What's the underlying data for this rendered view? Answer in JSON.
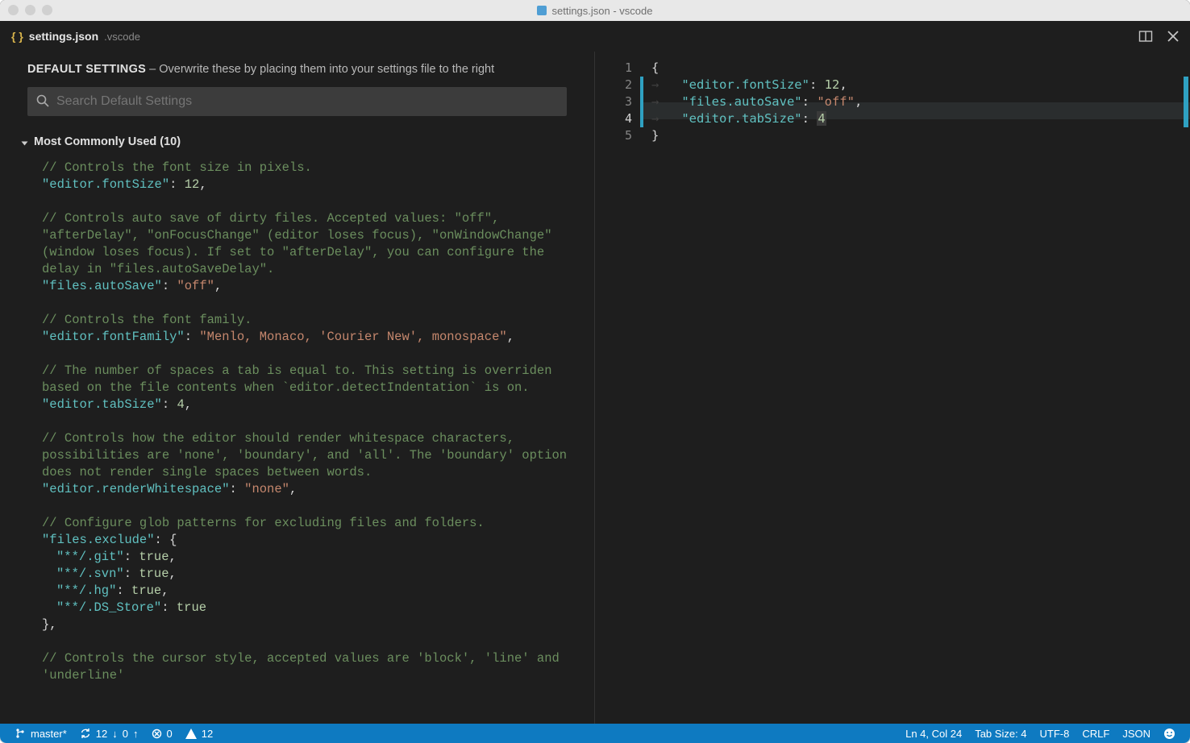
{
  "titlebar": {
    "title": "settings.json - vscode"
  },
  "tab": {
    "filename": "settings.json",
    "folder": ".vscode"
  },
  "defaultSettings": {
    "heading": "DEFAULT SETTINGS",
    "hint": " – Overwrite these by placing them into your settings file to the right",
    "searchPlaceholder": "Search Default Settings",
    "section": "Most Commonly Used (10)",
    "entries": [
      {
        "comment": "// Controls the font size in pixels.",
        "key": "\"editor.fontSize\"",
        "value": "12",
        "vtype": "num",
        "trail": ","
      },
      {
        "comment": "// Controls auto save of dirty files. Accepted values:  \"off\", \"afterDelay\", \"onFocusChange\" (editor loses focus), \"onWindowChange\" (window loses focus). If set to \"afterDelay\", you can configure the delay in \"files.autoSaveDelay\".",
        "key": "\"files.autoSave\"",
        "value": "\"off\"",
        "vtype": "str",
        "trail": ","
      },
      {
        "comment": "// Controls the font family.",
        "key": "\"editor.fontFamily\"",
        "value": "\"Menlo, Monaco, 'Courier New', monospace\"",
        "vtype": "str",
        "trail": ","
      },
      {
        "comment": "// The number of spaces a tab is equal to. This setting is overriden based on the file contents when `editor.detectIndentation` is on.",
        "key": "\"editor.tabSize\"",
        "value": "4",
        "vtype": "num",
        "trail": ","
      },
      {
        "comment": "// Controls how the editor should render whitespace characters, possibilities are 'none', 'boundary', and 'all'. The 'boundary' option does not render single spaces between words.",
        "key": "\"editor.renderWhitespace\"",
        "value": "\"none\"",
        "vtype": "str",
        "trail": ","
      },
      {
        "comment": "// Configure glob patterns for excluding files and folders.",
        "key": "\"files.exclude\"",
        "objectLines": [
          {
            "k": "\"**/.git\"",
            "v": "true",
            "trail": ","
          },
          {
            "k": "\"**/.svn\"",
            "v": "true",
            "trail": ","
          },
          {
            "k": "\"**/.hg\"",
            "v": "true",
            "trail": ","
          },
          {
            "k": "\"**/.DS_Store\"",
            "v": "true",
            "trail": ""
          }
        ],
        "closeTrail": ","
      },
      {
        "comment": "// Controls the cursor style, accepted values are 'block', 'line' and 'underline'"
      }
    ]
  },
  "userSettings": {
    "highlightLine": 4,
    "lines": [
      {
        "n": 1,
        "tokens": [
          {
            "t": "{",
            "c": "punct"
          }
        ]
      },
      {
        "n": 2,
        "indent": 1,
        "tokens": [
          {
            "t": "\"editor.fontSize\"",
            "c": "key"
          },
          {
            "t": ": ",
            "c": "punct"
          },
          {
            "t": "12",
            "c": "num"
          },
          {
            "t": ",",
            "c": "punct"
          }
        ]
      },
      {
        "n": 3,
        "indent": 1,
        "tokens": [
          {
            "t": "\"files.autoSave\"",
            "c": "key"
          },
          {
            "t": ": ",
            "c": "punct"
          },
          {
            "t": "\"off\"",
            "c": "str"
          },
          {
            "t": ",",
            "c": "punct"
          }
        ]
      },
      {
        "n": 4,
        "indent": 1,
        "tokens": [
          {
            "t": "\"editor.tabSize\"",
            "c": "key"
          },
          {
            "t": ": ",
            "c": "punct"
          },
          {
            "t": "4",
            "c": "num",
            "boxed": true
          }
        ]
      },
      {
        "n": 5,
        "tokens": [
          {
            "t": "}",
            "c": "punct"
          }
        ]
      }
    ]
  },
  "statusbar": {
    "branch": "master*",
    "syncDown": "12",
    "syncUp": "0",
    "errors": "0",
    "warnings": "12",
    "cursor": "Ln 4, Col 24",
    "tabSize": "Tab Size: 4",
    "encoding": "UTF-8",
    "eol": "CRLF",
    "language": "JSON"
  }
}
